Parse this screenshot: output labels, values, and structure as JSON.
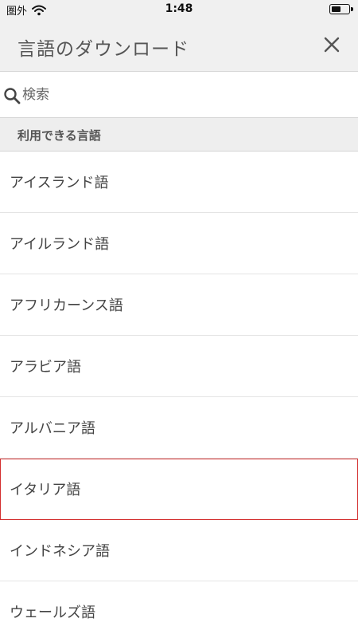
{
  "status_bar": {
    "carrier": "圏外",
    "time": "1:48"
  },
  "header": {
    "title": "言語のダウンロード",
    "close_icon": "close-icon"
  },
  "search": {
    "placeholder": "検索",
    "value": ""
  },
  "section": {
    "title": "利用できる言語"
  },
  "languages": [
    {
      "label": "アイスランド語"
    },
    {
      "label": "アイルランド語"
    },
    {
      "label": "アフリカーンス語"
    },
    {
      "label": "アラビア語"
    },
    {
      "label": "アルバニア語"
    },
    {
      "label": "イタリア語"
    },
    {
      "label": "インドネシア語"
    },
    {
      "label": "ウェールズ語"
    }
  ],
  "highlight_color": "#d32f2f"
}
